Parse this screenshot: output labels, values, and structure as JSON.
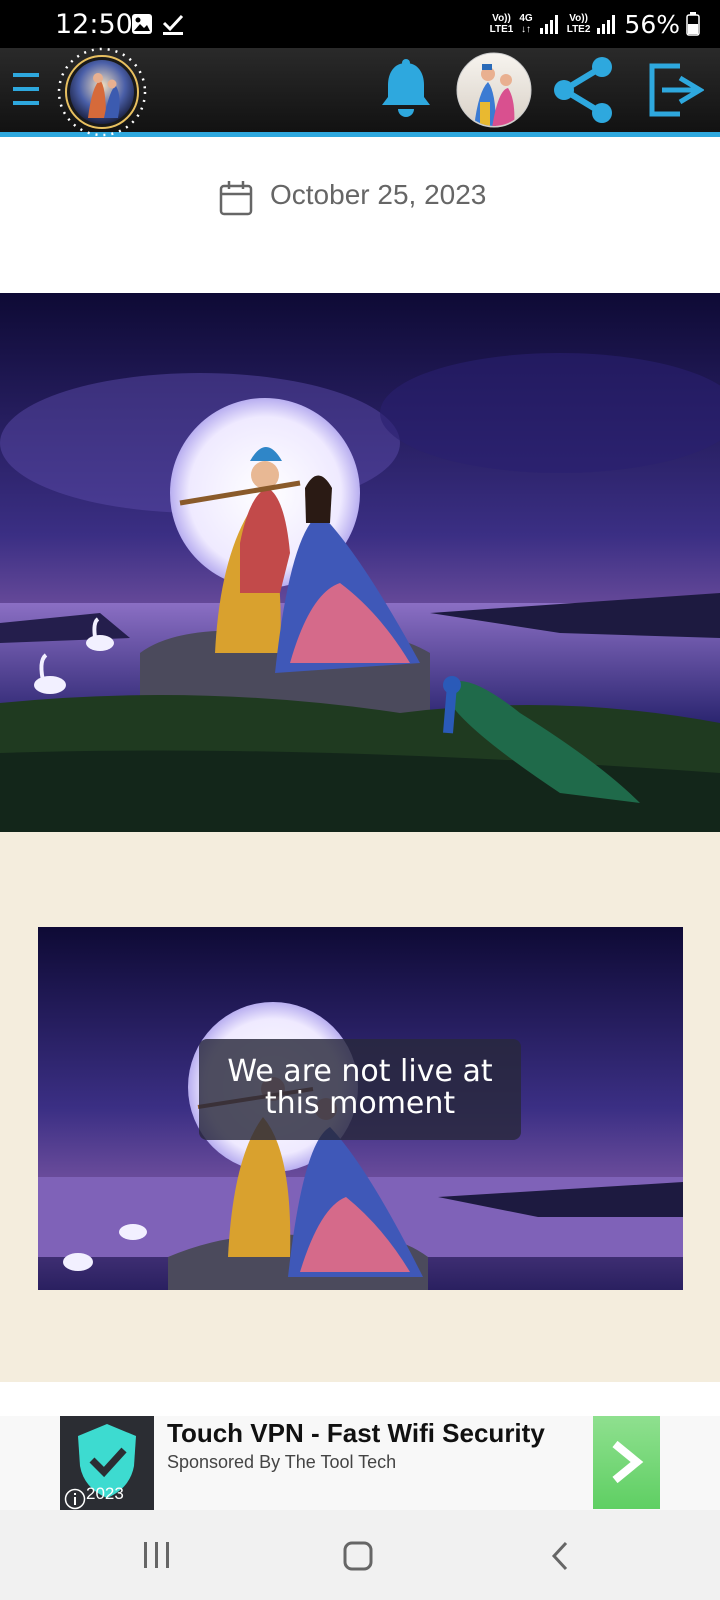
{
  "status_bar": {
    "time": "12:50",
    "net1_top": "Vo))",
    "net1_bottom": "LTE1",
    "net_type": "4G",
    "net2_top": "Vo))",
    "net2_bottom": "LTE2",
    "battery": "56%"
  },
  "app_bar": {
    "accent": "#2ea8de",
    "icons": [
      "menu-icon",
      "logo-avatar",
      "bell-icon",
      "profile-avatar",
      "share-icon",
      "logout-icon"
    ]
  },
  "post": {
    "date": "October 25, 2023"
  },
  "live": {
    "message_line1": "We are not live at",
    "message_line2": "this moment"
  },
  "ad": {
    "title": "Touch VPN - Fast Wifi Security",
    "sponsor": "Sponsored By The Tool Tech",
    "year": "2023"
  },
  "colors": {
    "beige": "#f4eddd",
    "status_bar": "#000000",
    "ad_cta": "#6fd86f"
  }
}
